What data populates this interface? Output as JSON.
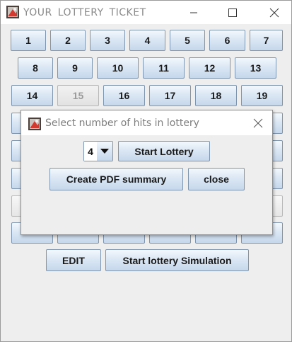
{
  "window": {
    "title": "YOUR  LOTTERY  TICKET",
    "controls": [
      "minimize",
      "maximize",
      "close"
    ]
  },
  "grid": {
    "numbers": [
      {
        "label": "1",
        "enabled": true
      },
      {
        "label": "2",
        "enabled": true
      },
      {
        "label": "3",
        "enabled": true
      },
      {
        "label": "4",
        "enabled": true
      },
      {
        "label": "5",
        "enabled": true
      },
      {
        "label": "6",
        "enabled": true
      },
      {
        "label": "7",
        "enabled": true
      },
      {
        "label": "8",
        "enabled": true
      },
      {
        "label": "9",
        "enabled": true
      },
      {
        "label": "10",
        "enabled": true
      },
      {
        "label": "11",
        "enabled": true
      },
      {
        "label": "12",
        "enabled": true
      },
      {
        "label": "13",
        "enabled": true
      },
      {
        "label": "14",
        "enabled": true
      },
      {
        "label": "15",
        "enabled": false
      },
      {
        "label": "16",
        "enabled": true
      },
      {
        "label": "17",
        "enabled": true
      },
      {
        "label": "18",
        "enabled": true
      },
      {
        "label": "19",
        "enabled": true
      }
    ]
  },
  "bottom": {
    "edit_label": "EDIT",
    "simulation_label": "Start lottery Simulation"
  },
  "dialog": {
    "title": "Select number of hits in lottery",
    "hits_value": "4",
    "start_label": "Start Lottery",
    "pdf_label": "Create PDF summary",
    "close_label": "close"
  },
  "colors": {
    "button_gradient_top": "#f3f8fd",
    "button_gradient_bottom": "#c6d8ec",
    "button_border": "#7f95ad",
    "background": "#eeeeee",
    "disabled_text": "#9a9a9a"
  }
}
